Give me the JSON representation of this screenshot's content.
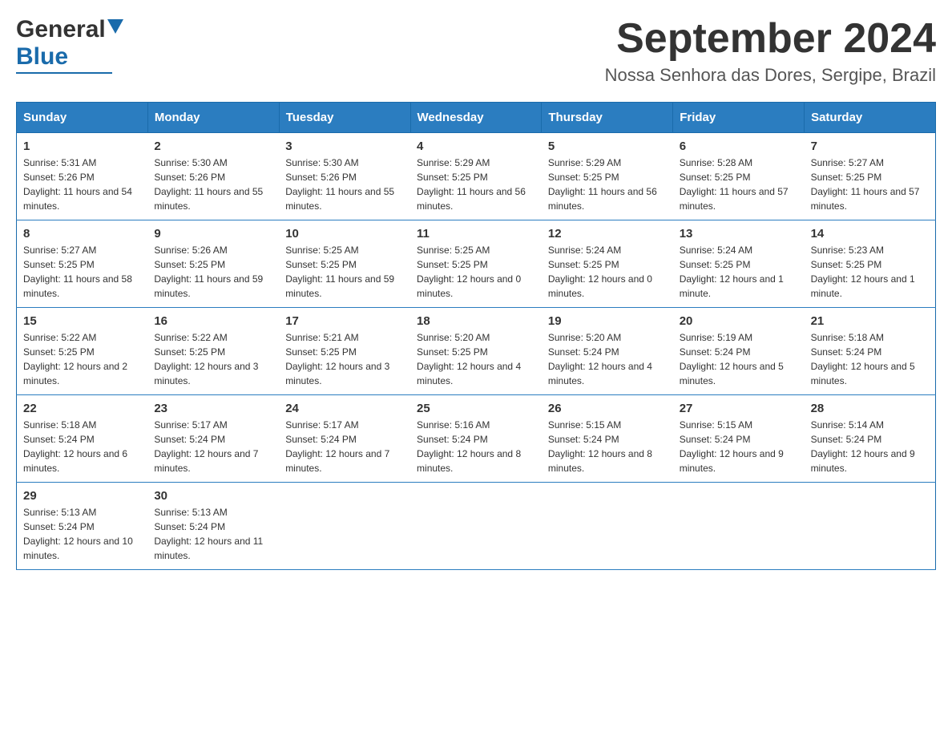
{
  "header": {
    "logo_general": "General",
    "logo_blue": "Blue",
    "month_title": "September 2024",
    "location": "Nossa Senhora das Dores, Sergipe, Brazil"
  },
  "weekdays": [
    "Sunday",
    "Monday",
    "Tuesday",
    "Wednesday",
    "Thursday",
    "Friday",
    "Saturday"
  ],
  "weeks": [
    [
      {
        "day": "1",
        "sunrise": "Sunrise: 5:31 AM",
        "sunset": "Sunset: 5:26 PM",
        "daylight": "Daylight: 11 hours and 54 minutes."
      },
      {
        "day": "2",
        "sunrise": "Sunrise: 5:30 AM",
        "sunset": "Sunset: 5:26 PM",
        "daylight": "Daylight: 11 hours and 55 minutes."
      },
      {
        "day": "3",
        "sunrise": "Sunrise: 5:30 AM",
        "sunset": "Sunset: 5:26 PM",
        "daylight": "Daylight: 11 hours and 55 minutes."
      },
      {
        "day": "4",
        "sunrise": "Sunrise: 5:29 AM",
        "sunset": "Sunset: 5:25 PM",
        "daylight": "Daylight: 11 hours and 56 minutes."
      },
      {
        "day": "5",
        "sunrise": "Sunrise: 5:29 AM",
        "sunset": "Sunset: 5:25 PM",
        "daylight": "Daylight: 11 hours and 56 minutes."
      },
      {
        "day": "6",
        "sunrise": "Sunrise: 5:28 AM",
        "sunset": "Sunset: 5:25 PM",
        "daylight": "Daylight: 11 hours and 57 minutes."
      },
      {
        "day": "7",
        "sunrise": "Sunrise: 5:27 AM",
        "sunset": "Sunset: 5:25 PM",
        "daylight": "Daylight: 11 hours and 57 minutes."
      }
    ],
    [
      {
        "day": "8",
        "sunrise": "Sunrise: 5:27 AM",
        "sunset": "Sunset: 5:25 PM",
        "daylight": "Daylight: 11 hours and 58 minutes."
      },
      {
        "day": "9",
        "sunrise": "Sunrise: 5:26 AM",
        "sunset": "Sunset: 5:25 PM",
        "daylight": "Daylight: 11 hours and 59 minutes."
      },
      {
        "day": "10",
        "sunrise": "Sunrise: 5:25 AM",
        "sunset": "Sunset: 5:25 PM",
        "daylight": "Daylight: 11 hours and 59 minutes."
      },
      {
        "day": "11",
        "sunrise": "Sunrise: 5:25 AM",
        "sunset": "Sunset: 5:25 PM",
        "daylight": "Daylight: 12 hours and 0 minutes."
      },
      {
        "day": "12",
        "sunrise": "Sunrise: 5:24 AM",
        "sunset": "Sunset: 5:25 PM",
        "daylight": "Daylight: 12 hours and 0 minutes."
      },
      {
        "day": "13",
        "sunrise": "Sunrise: 5:24 AM",
        "sunset": "Sunset: 5:25 PM",
        "daylight": "Daylight: 12 hours and 1 minute."
      },
      {
        "day": "14",
        "sunrise": "Sunrise: 5:23 AM",
        "sunset": "Sunset: 5:25 PM",
        "daylight": "Daylight: 12 hours and 1 minute."
      }
    ],
    [
      {
        "day": "15",
        "sunrise": "Sunrise: 5:22 AM",
        "sunset": "Sunset: 5:25 PM",
        "daylight": "Daylight: 12 hours and 2 minutes."
      },
      {
        "day": "16",
        "sunrise": "Sunrise: 5:22 AM",
        "sunset": "Sunset: 5:25 PM",
        "daylight": "Daylight: 12 hours and 3 minutes."
      },
      {
        "day": "17",
        "sunrise": "Sunrise: 5:21 AM",
        "sunset": "Sunset: 5:25 PM",
        "daylight": "Daylight: 12 hours and 3 minutes."
      },
      {
        "day": "18",
        "sunrise": "Sunrise: 5:20 AM",
        "sunset": "Sunset: 5:25 PM",
        "daylight": "Daylight: 12 hours and 4 minutes."
      },
      {
        "day": "19",
        "sunrise": "Sunrise: 5:20 AM",
        "sunset": "Sunset: 5:24 PM",
        "daylight": "Daylight: 12 hours and 4 minutes."
      },
      {
        "day": "20",
        "sunrise": "Sunrise: 5:19 AM",
        "sunset": "Sunset: 5:24 PM",
        "daylight": "Daylight: 12 hours and 5 minutes."
      },
      {
        "day": "21",
        "sunrise": "Sunrise: 5:18 AM",
        "sunset": "Sunset: 5:24 PM",
        "daylight": "Daylight: 12 hours and 5 minutes."
      }
    ],
    [
      {
        "day": "22",
        "sunrise": "Sunrise: 5:18 AM",
        "sunset": "Sunset: 5:24 PM",
        "daylight": "Daylight: 12 hours and 6 minutes."
      },
      {
        "day": "23",
        "sunrise": "Sunrise: 5:17 AM",
        "sunset": "Sunset: 5:24 PM",
        "daylight": "Daylight: 12 hours and 7 minutes."
      },
      {
        "day": "24",
        "sunrise": "Sunrise: 5:17 AM",
        "sunset": "Sunset: 5:24 PM",
        "daylight": "Daylight: 12 hours and 7 minutes."
      },
      {
        "day": "25",
        "sunrise": "Sunrise: 5:16 AM",
        "sunset": "Sunset: 5:24 PM",
        "daylight": "Daylight: 12 hours and 8 minutes."
      },
      {
        "day": "26",
        "sunrise": "Sunrise: 5:15 AM",
        "sunset": "Sunset: 5:24 PM",
        "daylight": "Daylight: 12 hours and 8 minutes."
      },
      {
        "day": "27",
        "sunrise": "Sunrise: 5:15 AM",
        "sunset": "Sunset: 5:24 PM",
        "daylight": "Daylight: 12 hours and 9 minutes."
      },
      {
        "day": "28",
        "sunrise": "Sunrise: 5:14 AM",
        "sunset": "Sunset: 5:24 PM",
        "daylight": "Daylight: 12 hours and 9 minutes."
      }
    ],
    [
      {
        "day": "29",
        "sunrise": "Sunrise: 5:13 AM",
        "sunset": "Sunset: 5:24 PM",
        "daylight": "Daylight: 12 hours and 10 minutes."
      },
      {
        "day": "30",
        "sunrise": "Sunrise: 5:13 AM",
        "sunset": "Sunset: 5:24 PM",
        "daylight": "Daylight: 12 hours and 11 minutes."
      },
      null,
      null,
      null,
      null,
      null
    ]
  ],
  "colors": {
    "header_bg": "#2b7dc0",
    "border": "#1a6bab",
    "logo_blue": "#1a6bab"
  }
}
